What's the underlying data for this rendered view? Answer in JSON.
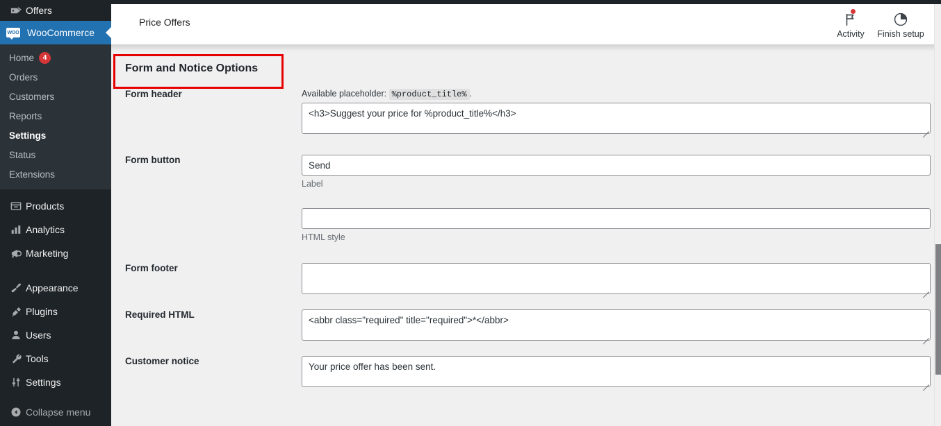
{
  "sidebar": {
    "top_item": {
      "label": "Offers",
      "icon": "price-tag-icon"
    },
    "woocommerce": {
      "label": "WooCommerce",
      "badge_text": "WOO",
      "icon": "woocommerce-icon"
    },
    "submenu": [
      {
        "label": "Home",
        "count": "4",
        "current": false
      },
      {
        "label": "Orders",
        "count": "",
        "current": false
      },
      {
        "label": "Customers",
        "count": "",
        "current": false
      },
      {
        "label": "Reports",
        "count": "",
        "current": false
      },
      {
        "label": "Settings",
        "count": "",
        "current": true
      },
      {
        "label": "Status",
        "count": "",
        "current": false
      },
      {
        "label": "Extensions",
        "count": "",
        "current": false
      }
    ],
    "group_one": [
      {
        "label": "Products",
        "icon": "products-box-icon"
      },
      {
        "label": "Analytics",
        "icon": "bar-chart-icon"
      },
      {
        "label": "Marketing",
        "icon": "megaphone-icon"
      }
    ],
    "group_two": [
      {
        "label": "Appearance",
        "icon": "paintbrush-icon"
      },
      {
        "label": "Plugins",
        "icon": "plug-icon"
      },
      {
        "label": "Users",
        "icon": "user-icon"
      },
      {
        "label": "Tools",
        "icon": "wrench-icon"
      },
      {
        "label": "Settings",
        "icon": "sliders-icon"
      }
    ],
    "collapse": {
      "label": "Collapse menu",
      "icon": "collapse-arrow-icon"
    }
  },
  "header": {
    "title": "Price Offers",
    "activity": {
      "label": "Activity",
      "icon": "flag-icon",
      "has_notification": true
    },
    "finish_setup": {
      "label": "Finish setup",
      "icon": "progress-circle-icon"
    }
  },
  "section": {
    "title": "Form and Notice Options",
    "highlight_color": "#e60000"
  },
  "fields": {
    "form_header": {
      "label": "Form header",
      "hint_prefix": "Available placeholder:",
      "hint_code": "%product_title%",
      "hint_suffix": ".",
      "value": "<h3>Suggest your price for %product_title%</h3>"
    },
    "form_button_label": {
      "label": "Form button",
      "value": "Send",
      "hint": "Label"
    },
    "form_button_style": {
      "value": "",
      "hint": "HTML style"
    },
    "form_footer": {
      "label": "Form footer",
      "value": ""
    },
    "required_html": {
      "label": "Required HTML",
      "value": "<abbr class=\"required\" title=\"required\">*</abbr>"
    },
    "customer_notice": {
      "label": "Customer notice",
      "value": "Your price offer has been sent."
    }
  }
}
